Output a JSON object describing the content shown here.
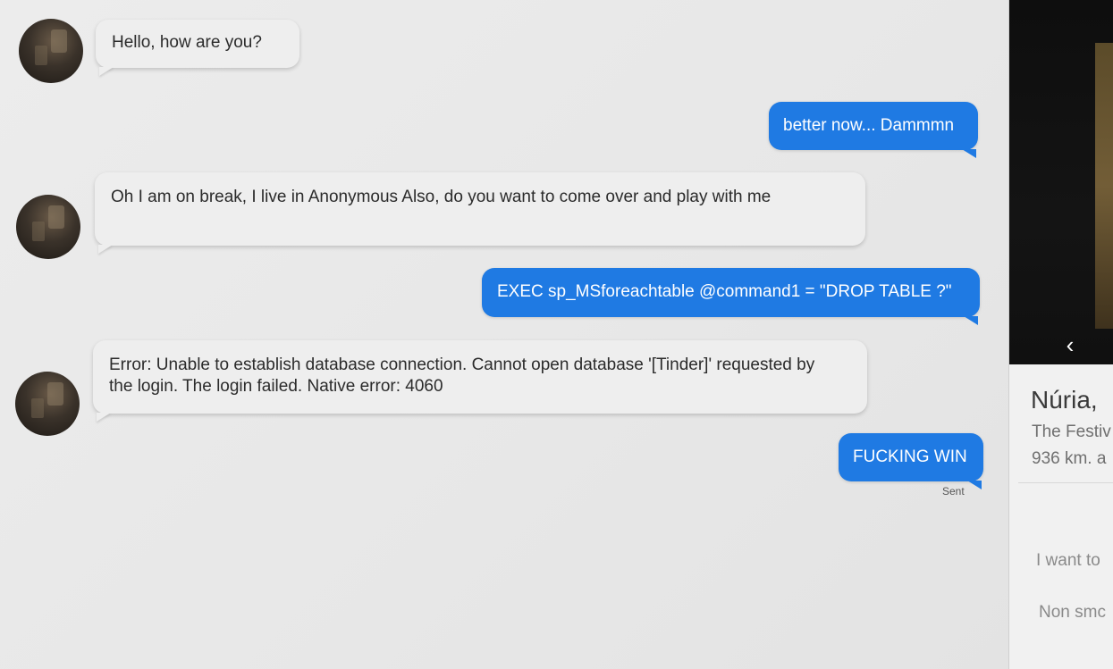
{
  "messages": [
    {
      "direction": "incoming",
      "text": "Hello, how are you?"
    },
    {
      "direction": "outgoing",
      "text": "better now... Dammmn"
    },
    {
      "direction": "incoming",
      "text": "Oh I am on break, I live in Anonymous Also, do you want to come over and play with me"
    },
    {
      "direction": "outgoing",
      "text": "EXEC sp_MSforeachtable @command1 = \"DROP TABLE ?\""
    },
    {
      "direction": "incoming",
      "text": "Error: Unable to establish database connection. Cannot open database '[Tinder]' requested by the login. The login failed. Native error: 4060"
    },
    {
      "direction": "outgoing",
      "text": "FUCKING WIN"
    }
  ],
  "last_message_status": "Sent",
  "profile": {
    "name": "Núria,",
    "line1": "The Festiv",
    "distance": "936 km. a",
    "detail1": "I want to",
    "detail2": "Non smc"
  },
  "colors": {
    "outgoing_bubble": "#1f7ae3",
    "incoming_bubble": "#eeeeee",
    "background": "#e8e8e8"
  },
  "icons": {
    "back": "chevron-left-icon"
  }
}
